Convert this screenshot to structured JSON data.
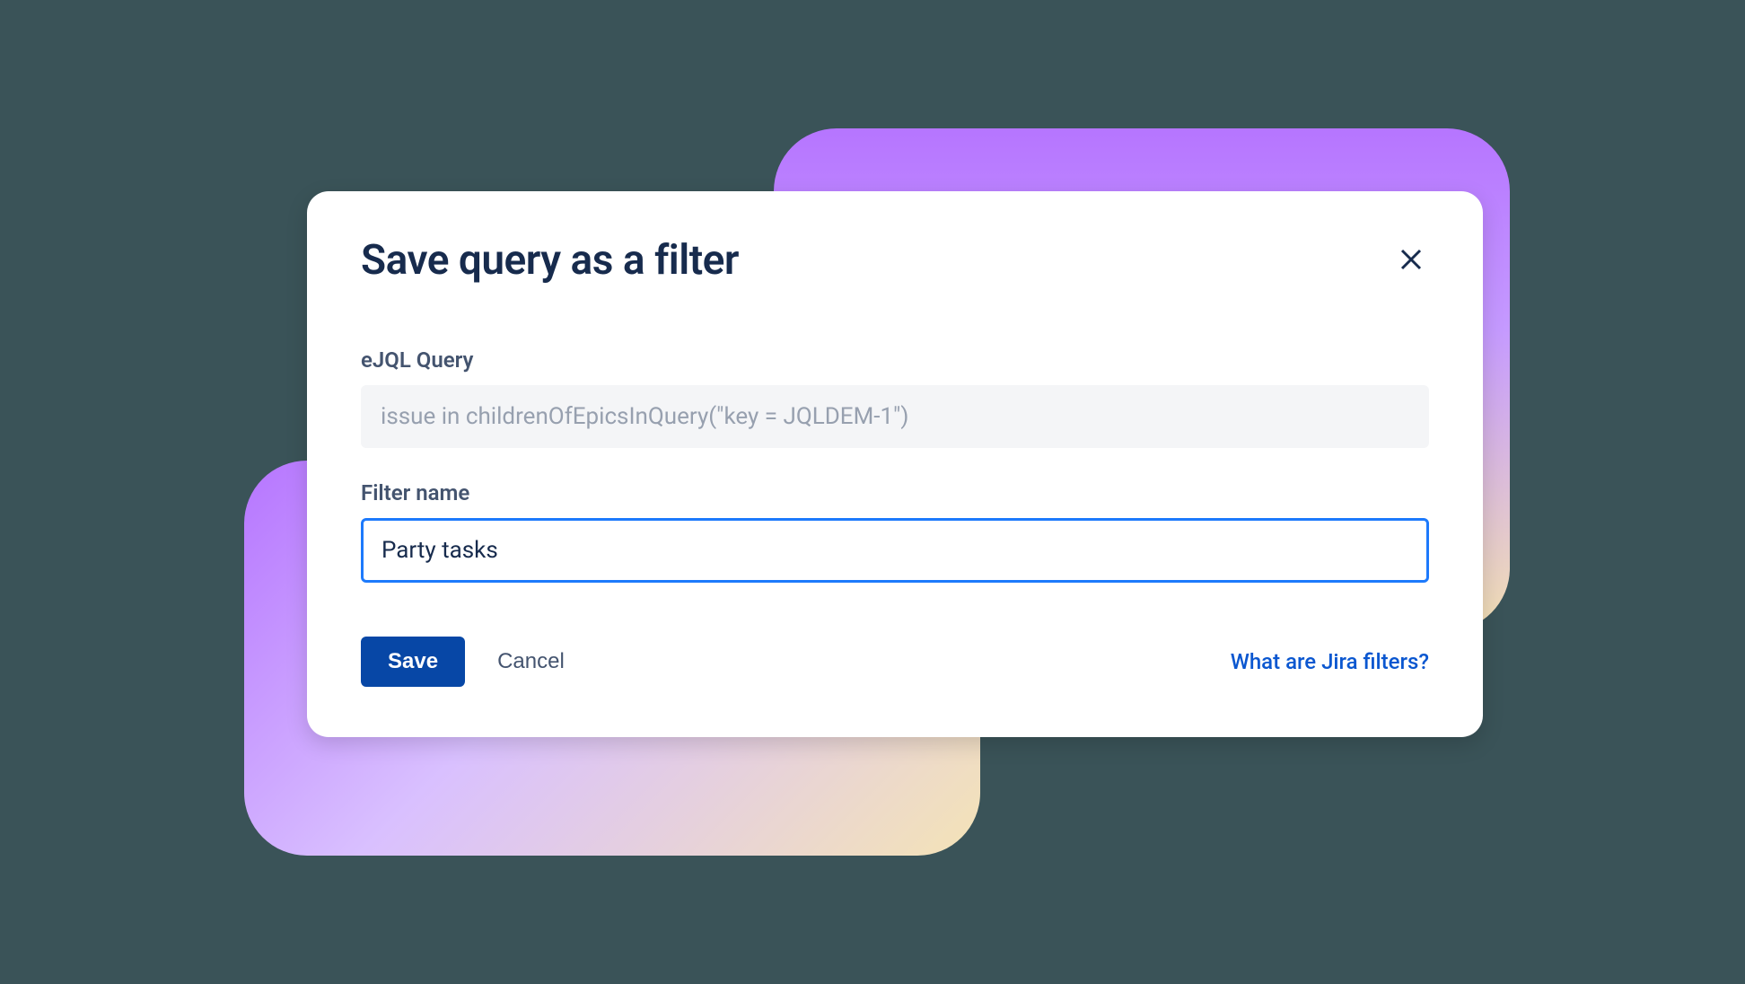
{
  "modal": {
    "title": "Save query as a filter",
    "fields": {
      "query_label": "eJQL Query",
      "query_value": "issue in childrenOfEpicsInQuery(\"key = JQLDEM-1\")",
      "name_label": "Filter name",
      "name_value": "Party tasks"
    },
    "actions": {
      "save": "Save",
      "cancel": "Cancel",
      "help": "What are Jira filters?"
    }
  }
}
